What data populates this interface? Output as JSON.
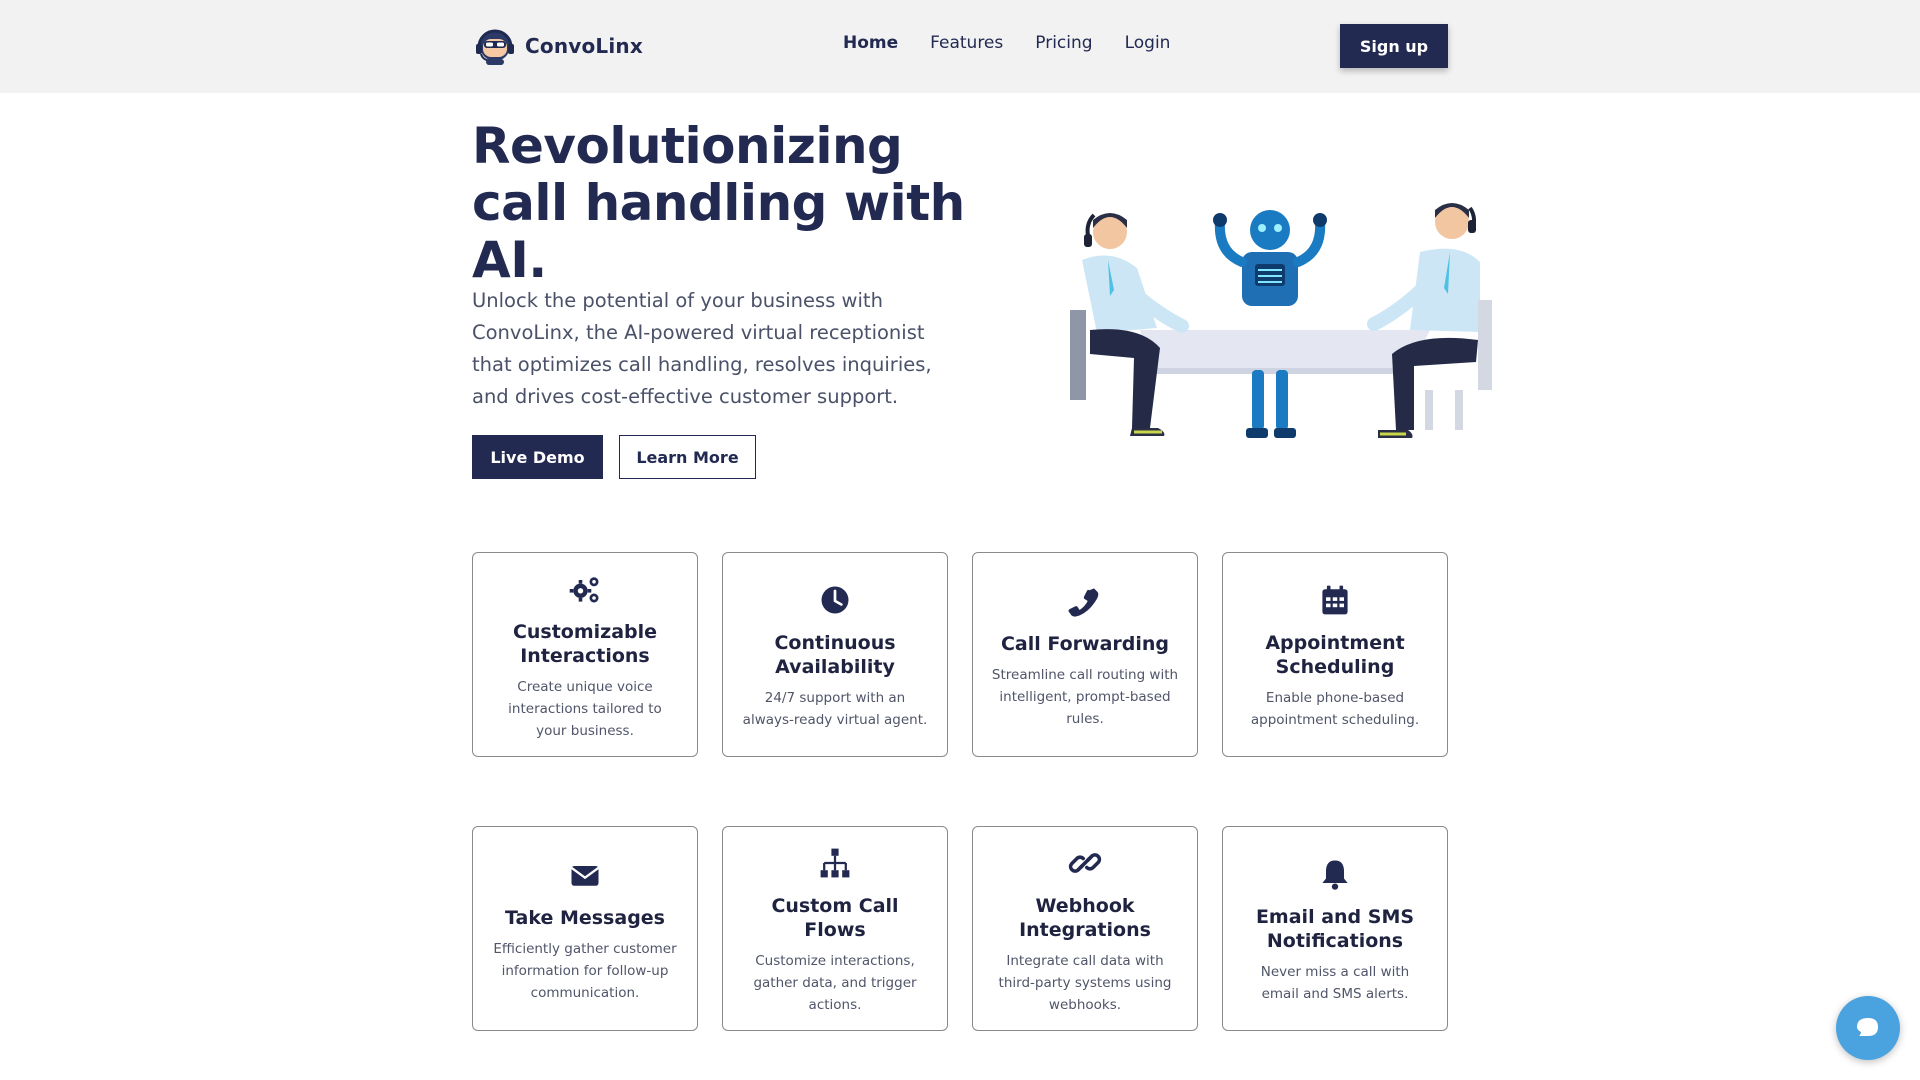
{
  "brand": {
    "name": "ConvoLinx",
    "logo_icon": "robot-headset-logo"
  },
  "nav": {
    "items": [
      {
        "label": "Home",
        "active": true
      },
      {
        "label": "Features",
        "active": false
      },
      {
        "label": "Pricing",
        "active": false
      },
      {
        "label": "Login",
        "active": false
      }
    ],
    "signup_label": "Sign up"
  },
  "hero": {
    "title": "Revolutionizing call handling with AI.",
    "description": "Unlock the potential of your business with ConvoLinx, the AI-powered virtual receptionist that optimizes call handling, resolves inquiries, and drives cost-effective customer support.",
    "primary_button": "Live Demo",
    "secondary_button": "Learn More"
  },
  "features": [
    {
      "icon": "cogs-icon",
      "title": "Customizable Interactions",
      "description": "Create unique voice interactions tailored to your business."
    },
    {
      "icon": "clock-icon",
      "title": "Continuous Availability",
      "description": "24/7 support with an always-ready virtual agent."
    },
    {
      "icon": "phone-icon",
      "title": "Call Forwarding",
      "description": "Streamline call routing with intelligent, prompt-based rules."
    },
    {
      "icon": "calendar-icon",
      "title": "Appointment Scheduling",
      "description": "Enable phone-based appointment scheduling."
    },
    {
      "icon": "envelope-icon",
      "title": "Take Messages",
      "description": "Efficiently gather customer information for follow-up communication."
    },
    {
      "icon": "sitemap-icon",
      "title": "Custom Call Flows",
      "description": "Customize interactions, gather data, and trigger actions."
    },
    {
      "icon": "link-icon",
      "title": "Webhook Integrations",
      "description": "Integrate call data with third-party systems using webhooks."
    },
    {
      "icon": "bell-icon",
      "title": "Email and SMS Notifications",
      "description": "Never miss a call with email and SMS alerts."
    }
  ],
  "colors": {
    "navy": "#232a52",
    "chat_accent": "#4aa3df",
    "header_bg": "#f2f2f2"
  }
}
